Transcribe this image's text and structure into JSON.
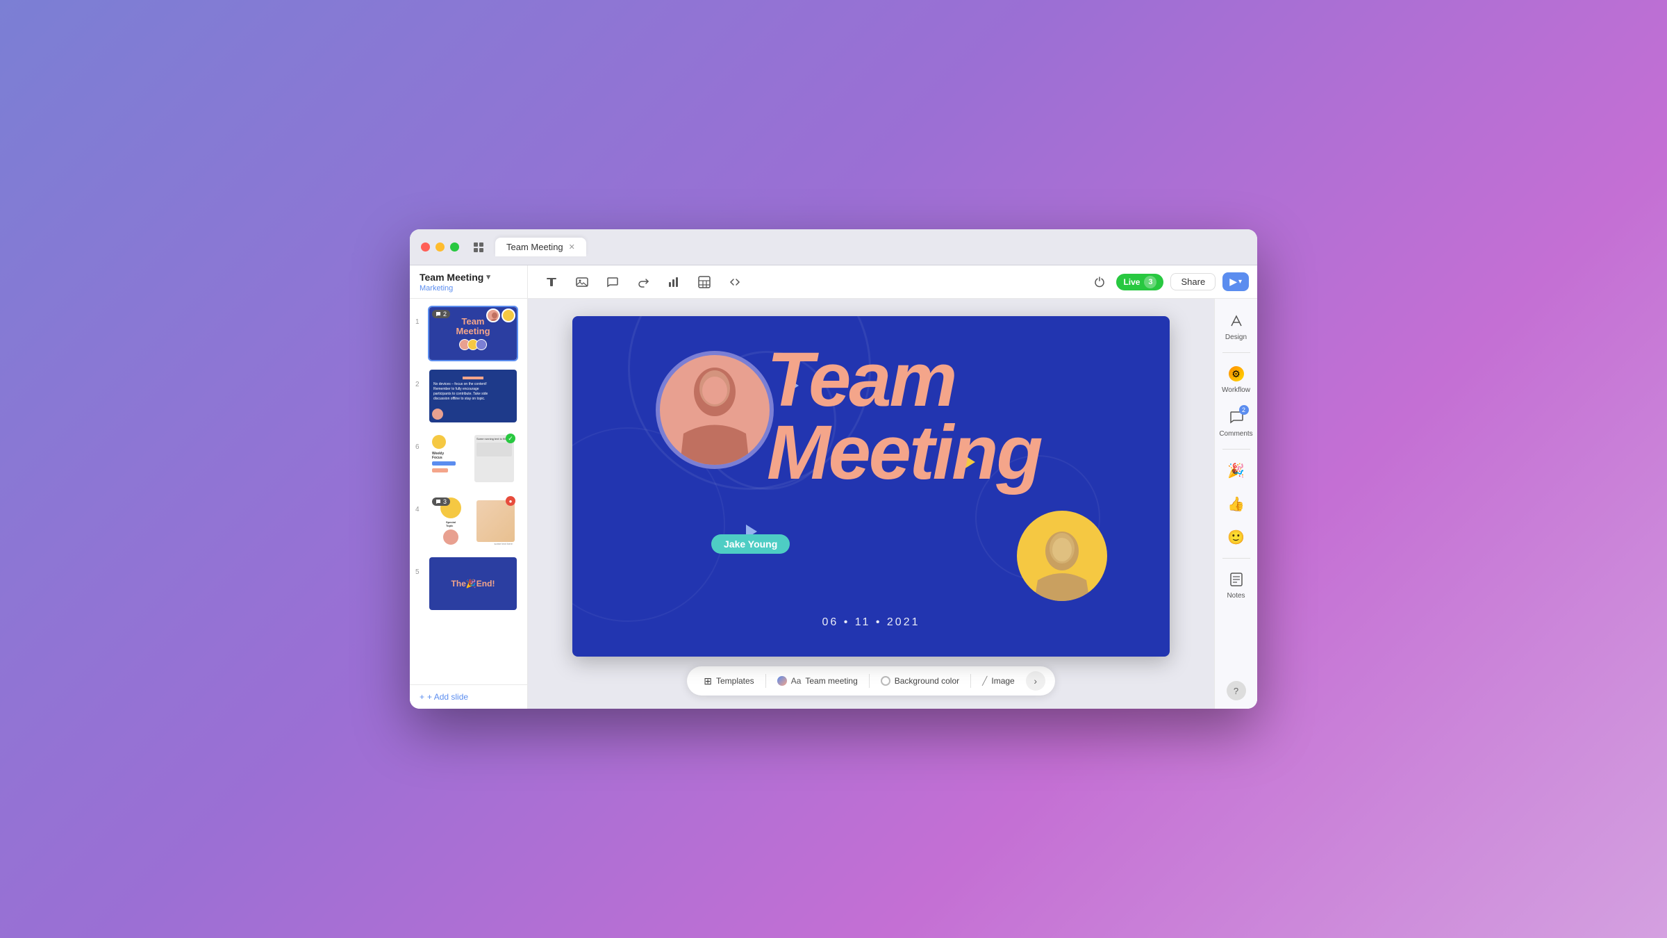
{
  "window": {
    "title": "Team Meeting",
    "tab_label": "Team Meeting"
  },
  "header": {
    "presentation_title": "Team Meeting",
    "subtitle": "Marketing",
    "live_label": "Live",
    "live_count": "3",
    "share_label": "Share"
  },
  "toolbar": {
    "icons": [
      "text",
      "shape",
      "comment",
      "redo",
      "chart",
      "table",
      "embed"
    ]
  },
  "slides": [
    {
      "number": "1",
      "active": true,
      "comment_count": "2",
      "title": "Team Meeting",
      "subtitle": ""
    },
    {
      "number": "2",
      "active": false,
      "title": "No devices slide"
    },
    {
      "number": "6",
      "active": false,
      "title": "Weekly Focus"
    },
    {
      "number": "4",
      "active": false,
      "comment_count": "3",
      "title": "Special Topic"
    },
    {
      "number": "5",
      "active": false,
      "title": "The End!"
    }
  ],
  "add_slide_label": "+ Add slide",
  "main_slide": {
    "title_line1": "Team",
    "title_line2": "Meeting",
    "date": "06 • 11 • 2021",
    "person1_name": "Jake Young",
    "avatar_colors": {
      "woman": "#e8a090",
      "man": "#f5c842",
      "ring": "#7B7FD4"
    }
  },
  "bottom_bar": {
    "templates_label": "Templates",
    "theme_label": "Team meeting",
    "bg_color_label": "Background color",
    "image_label": "Image"
  },
  "right_panel": {
    "design_label": "Design",
    "workflow_label": "Workflow",
    "comments_label": "Comments",
    "comments_count": "2",
    "notes_label": "Notes"
  }
}
